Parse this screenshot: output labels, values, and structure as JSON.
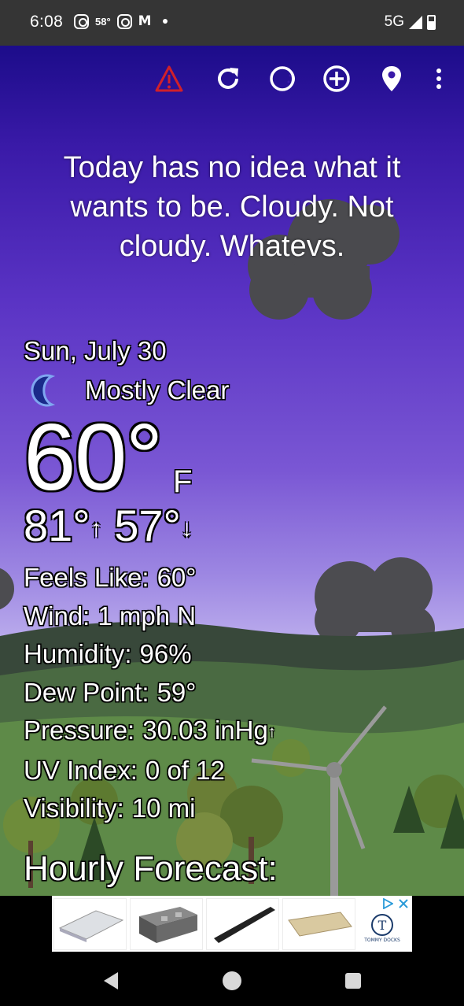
{
  "status_bar": {
    "time": "6:08",
    "temp": "58°",
    "network": "5G",
    "icons": [
      "instagram-icon",
      "weather-temp",
      "instagram-icon",
      "gmail-icon",
      "dot-icon",
      "signal-icon",
      "battery-icon"
    ]
  },
  "toolbar": {
    "icons": [
      "alert-icon",
      "refresh-icon",
      "theme-icon",
      "add-location-icon",
      "location-pin-icon",
      "more-vert-icon"
    ],
    "alert_color": "#d0202a"
  },
  "tagline": "Today has no idea what it wants to be. Cloudy. Not cloudy. Whatevs.",
  "weather": {
    "date": "Sun, July 30",
    "condition": "Mostly Clear",
    "condition_icon": "moon-icon",
    "temperature": "60°",
    "unit": "F",
    "high": "81°",
    "low": "57°",
    "details": {
      "feels_like_label": "Feels Like:",
      "feels_like": "60°",
      "wind_label": "Wind:",
      "wind": "1 mph N",
      "humidity_label": "Humidity:",
      "humidity": "96%",
      "dew_point_label": "Dew Point:",
      "dew_point": "59°",
      "pressure_label": "Pressure:",
      "pressure": "30.03 inHg",
      "uv_label": "UV Index:",
      "uv": "0 of 12",
      "visibility_label": "Visibility:",
      "visibility": "10 mi"
    },
    "hourly_heading": "Hourly Forecast:"
  },
  "ad": {
    "brand": "TOMMY DOCKS"
  },
  "navbar": {
    "icons": [
      "back-icon",
      "home-icon",
      "recents-icon"
    ]
  }
}
